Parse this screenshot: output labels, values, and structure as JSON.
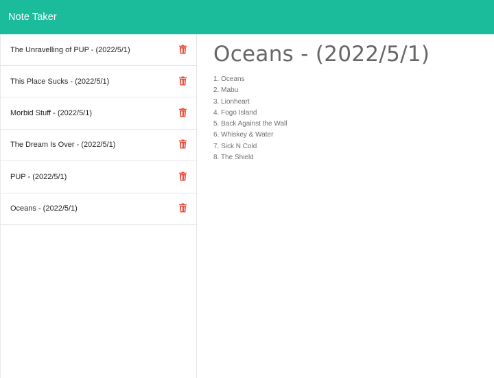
{
  "app": {
    "title": "Note Taker"
  },
  "colors": {
    "navbar": "#1abc9c",
    "trash": "#e74c3c"
  },
  "sidebar": {
    "notes": [
      {
        "title": "The Unravelling of PUP - (2022/5/1)",
        "icon": "trash-icon"
      },
      {
        "title": "This Place Sucks - (2022/5/1)",
        "icon": "trash-icon"
      },
      {
        "title": "Morbid Stuff - (2022/5/1)",
        "icon": "trash-icon"
      },
      {
        "title": "The Dream Is Over - (2022/5/1)",
        "icon": "trash-icon"
      },
      {
        "title": "PUP - (2022/5/1)",
        "icon": "trash-icon"
      },
      {
        "title": "Oceans - (2022/5/1)",
        "icon": "trash-icon"
      }
    ]
  },
  "main": {
    "note_title": "Oceans - (2022/5/1)",
    "note_lines": [
      "1. Oceans",
      "2. Mabu",
      "3. Lionheart",
      "4. Fogo Island",
      "5. Back Against the Wall",
      "6. Whiskey & Water",
      "7. Sick N Cold",
      "8. The Shield"
    ]
  }
}
